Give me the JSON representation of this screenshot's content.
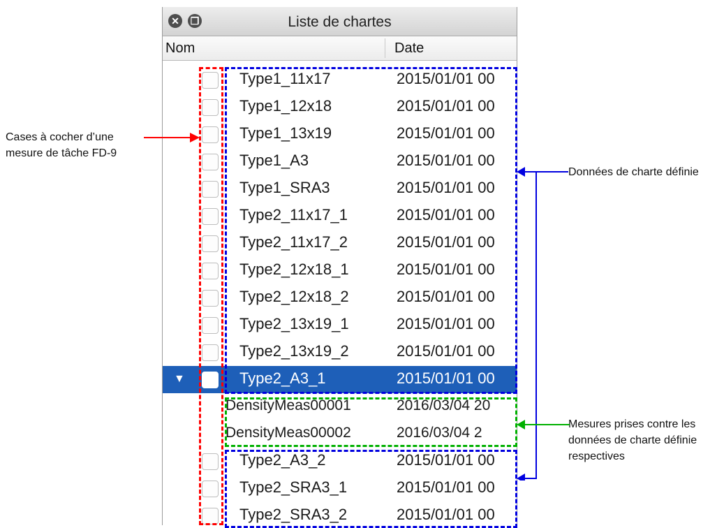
{
  "window": {
    "title": "Liste de chartes",
    "close_symbol": "✕",
    "restore_symbol": "❐"
  },
  "columns": {
    "name": "Nom",
    "date": "Date"
  },
  "rows": [
    {
      "name": "Type1_11x17",
      "date": "2015/01/01 00",
      "checkbox": true,
      "selected": false
    },
    {
      "name": "Type1_12x18",
      "date": "2015/01/01 00",
      "checkbox": true,
      "selected": false
    },
    {
      "name": "Type1_13x19",
      "date": "2015/01/01 00",
      "checkbox": true,
      "selected": false
    },
    {
      "name": "Type1_A3",
      "date": "2015/01/01 00",
      "checkbox": true,
      "selected": false
    },
    {
      "name": "Type1_SRA3",
      "date": "2015/01/01 00",
      "checkbox": true,
      "selected": false
    },
    {
      "name": "Type2_11x17_1",
      "date": "2015/01/01 00",
      "checkbox": true,
      "selected": false
    },
    {
      "name": "Type2_11x17_2",
      "date": "2015/01/01 00",
      "checkbox": true,
      "selected": false
    },
    {
      "name": "Type2_12x18_1",
      "date": "2015/01/01 00",
      "checkbox": true,
      "selected": false
    },
    {
      "name": "Type2_12x18_2",
      "date": "2015/01/01 00",
      "checkbox": true,
      "selected": false
    },
    {
      "name": "Type2_13x19_1",
      "date": "2015/01/01 00",
      "checkbox": true,
      "selected": false
    },
    {
      "name": "Type2_13x19_2",
      "date": "2015/01/01 00",
      "checkbox": true,
      "selected": false
    },
    {
      "name": "Type2_A3_1",
      "date": "2015/01/01 00",
      "checkbox": true,
      "selected": true,
      "expanded": true
    },
    {
      "name": "DensityMeas00001",
      "date": "2016/03/04 20",
      "checkbox": false,
      "selected": false,
      "child": true
    },
    {
      "name": "DensityMeas00002",
      "date": "2016/03/04 2",
      "checkbox": false,
      "selected": false,
      "child": true
    },
    {
      "name": "Type2_A3_2",
      "date": "2015/01/01 00",
      "checkbox": true,
      "selected": false
    },
    {
      "name": "Type2_SRA3_1",
      "date": "2015/01/01 00",
      "checkbox": true,
      "selected": false
    },
    {
      "name": "Type2_SRA3_2",
      "date": "2015/01/01 00",
      "checkbox": true,
      "selected": false
    }
  ],
  "annotations": {
    "checkboxes": "Cases à cocher d’une\nmesure de tâche FD-9",
    "defined_data": "Données de charte définie",
    "measurements": "Mesures prises contre les\ndonnées de charte définie\nrespectives"
  },
  "colors": {
    "checkbox_annotation": "#ff0000",
    "defined_data_annotation": "#0000e0",
    "measurements_annotation": "#00b000",
    "selected_row": "#1e5fb8"
  },
  "icons": {
    "expand": "▼"
  }
}
